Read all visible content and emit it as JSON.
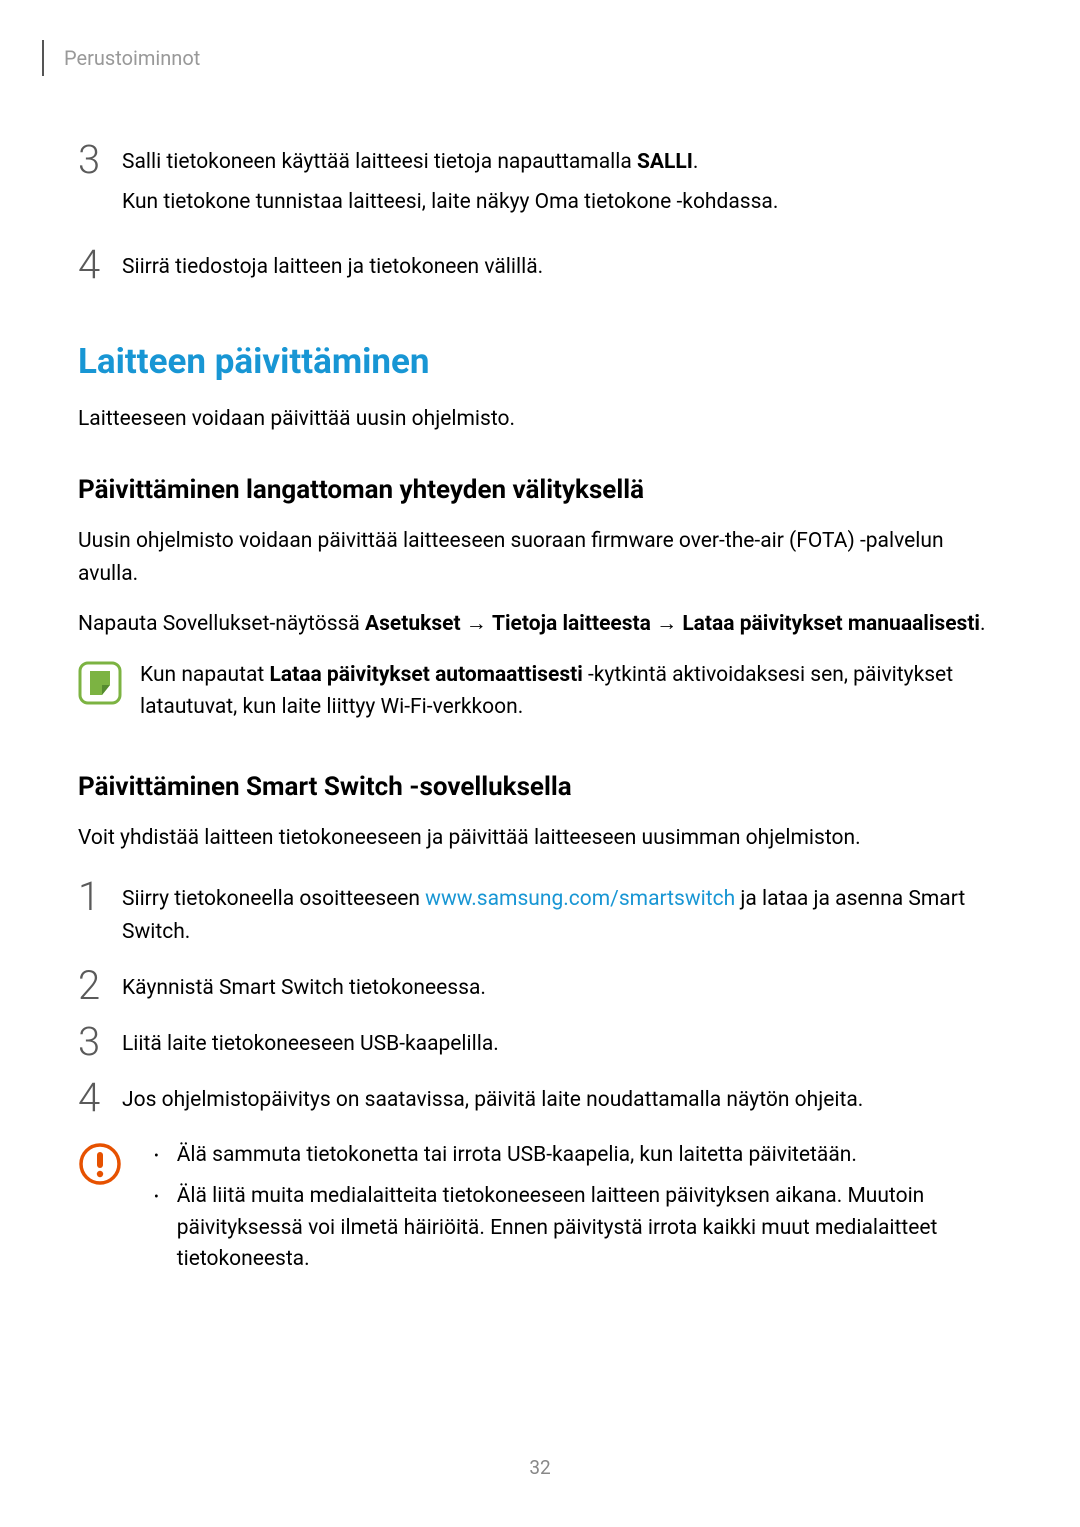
{
  "breadcrumb": "Perustoiminnot",
  "steps_top": [
    {
      "number": "3",
      "lines": [
        {
          "prefix": "Salli tietokoneen käyttää laitteesi tietoja napauttamalla ",
          "bold": "SALLI",
          "suffix": "."
        },
        {
          "text": "Kun tietokone tunnistaa laitteesi, laite näkyy Oma tietokone -kohdassa."
        }
      ]
    },
    {
      "number": "4",
      "lines": [
        {
          "text": "Siirrä tiedostoja laitteen ja tietokoneen välillä."
        }
      ]
    }
  ],
  "section_title": "Laitteen päivittäminen",
  "section_intro": "Laitteeseen voidaan päivittää uusin ohjelmisto.",
  "subsection1": {
    "title": "Päivittäminen langattoman yhteyden välityksellä",
    "body1": "Uusin ohjelmisto voidaan päivittää laitteeseen suoraan firmware over-the-air (FOTA) -palvelun avulla.",
    "body2_prefix": "Napauta Sovellukset-näytössä ",
    "body2_bold1": "Asetukset",
    "body2_arrow1": " → ",
    "body2_bold2": "Tietoja laitteesta",
    "body2_arrow2": " → ",
    "body2_bold3": "Lataa päivitykset manuaalisesti",
    "body2_suffix": ".",
    "note_prefix": "Kun napautat ",
    "note_bold": "Lataa päivitykset automaattisesti",
    "note_suffix": " -kytkintä aktivoidaksesi sen, päivitykset latautuvat, kun laite liittyy Wi-Fi-verkkoon."
  },
  "subsection2": {
    "title": "Päivittäminen Smart Switch -sovelluksella",
    "intro": "Voit yhdistää laitteen tietokoneeseen ja päivittää laitteeseen uusimman ohjelmiston.",
    "steps": [
      {
        "number": "1",
        "prefix": "Siirry tietokoneella osoitteeseen ",
        "link": "www.samsung.com/smartswitch",
        "suffix": " ja lataa ja asenna Smart Switch."
      },
      {
        "number": "2",
        "text": "Käynnistä Smart Switch tietokoneessa."
      },
      {
        "number": "3",
        "text": "Liitä laite tietokoneeseen USB-kaapelilla."
      },
      {
        "number": "4",
        "text": "Jos ohjelmistopäivitys on saatavissa, päivitä laite noudattamalla näytön ohjeita."
      }
    ],
    "warnings": [
      "Älä sammuta tietokonetta tai irrota USB-kaapelia, kun laitetta päivitetään.",
      "Älä liitä muita medialaitteita tietokoneeseen laitteen päivityksen aikana. Muutoin päivityksessä voi ilmetä häiriöitä. Ennen päivitystä irrota kaikki muut medialaitteet tietokoneesta."
    ]
  },
  "page_number": "32",
  "icons": {
    "note": "note-icon",
    "warning": "warning-icon"
  }
}
